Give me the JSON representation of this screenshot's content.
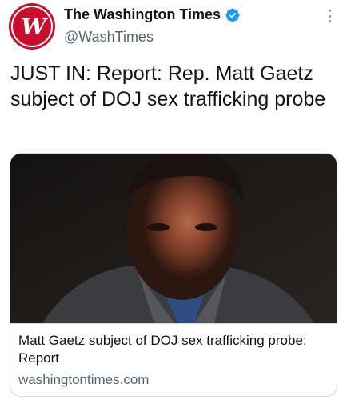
{
  "author": {
    "display_name": "The Washington Times",
    "handle": "@WashTimes",
    "avatar_icon": "washington-times-logo",
    "avatar_color": "#c8102e",
    "verified_color": "#1d9bf0"
  },
  "tweet": {
    "text": "JUST IN: Report: Rep. Matt Gaetz subject of DOJ sex trafficking probe"
  },
  "card": {
    "image": "photo of Matt Gaetz",
    "title": "Matt Gaetz subject of DOJ sex trafficking probe: Report",
    "domain": "washingtontimes.com"
  },
  "icons": {
    "more": "more-options-icon",
    "verified": "verified-badge-icon"
  }
}
